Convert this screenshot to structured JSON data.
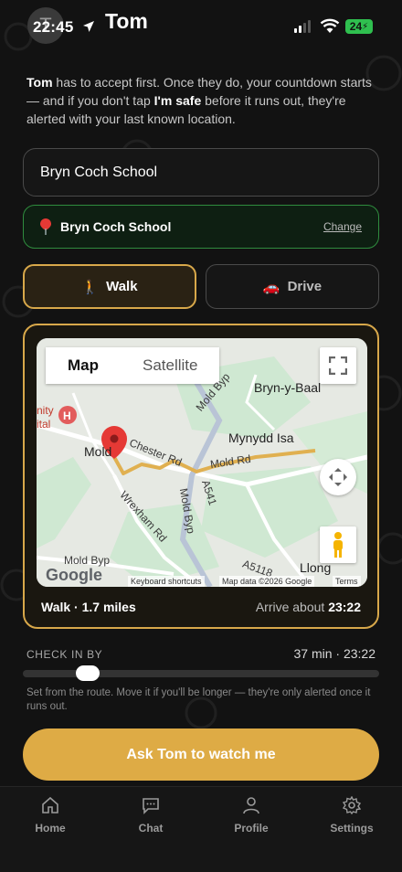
{
  "status_bar": {
    "time": "22:45",
    "battery": "24"
  },
  "header": {
    "avatar_initial": "T",
    "title": "Tom"
  },
  "intro": {
    "name": "Tom",
    "part1": " has to accept first. Once they do, your countdown starts — and if you don't tap ",
    "safe": "I'm safe",
    "part2": " before it runs out, they're alerted with your last known location."
  },
  "destination": {
    "value": "Bryn Coch School"
  },
  "selected_place": {
    "name": "Bryn Coch School",
    "change_label": "Change"
  },
  "modes": {
    "walk": "Walk",
    "drive": "Drive",
    "selected": "walk"
  },
  "map": {
    "tab_map": "Map",
    "tab_satellite": "Satellite",
    "labels": {
      "bryn_y_baal": "Bryn-y-Baal",
      "mynydd_isa": "Mynydd Isa",
      "mold": "Mold",
      "llong": "Llong",
      "chester_rd": "Chester Rd",
      "mold_rd": "Mold Rd",
      "wrexham_rd": "Wrexham Rd",
      "mold_byp_1": "Mold Byp",
      "mold_byp_2": "Mold Byp",
      "mold_byp_3": "Mold Byp",
      "a541": "A541",
      "a5118": "A5118",
      "hospital_1": "nity",
      "hospital_2": "ital"
    },
    "google": "Google",
    "keyboard": "Keyboard shortcuts",
    "map_data": "Map data ©2026 Google",
    "terms": "Terms"
  },
  "route": {
    "summary": "Walk · 1.7 miles",
    "arrive_prefix": "Arrive about ",
    "arrive_time": "23:22"
  },
  "checkin": {
    "label": "CHECK IN BY",
    "value": "37 min · 23:22",
    "slider_fraction": 0.16,
    "hint": "Set from the route. Move it if you'll be longer — they're only alerted once it runs out."
  },
  "cta": {
    "label": "Ask Tom to watch me"
  },
  "tabs": [
    {
      "label": "Home",
      "icon": "home-icon"
    },
    {
      "label": "Chat",
      "icon": "chat-icon"
    },
    {
      "label": "Profile",
      "icon": "person-icon"
    },
    {
      "label": "Settings",
      "icon": "gear-icon"
    }
  ],
  "colors": {
    "accent": "#deab45",
    "success": "#2f8c3e",
    "route": "#e0b050"
  }
}
